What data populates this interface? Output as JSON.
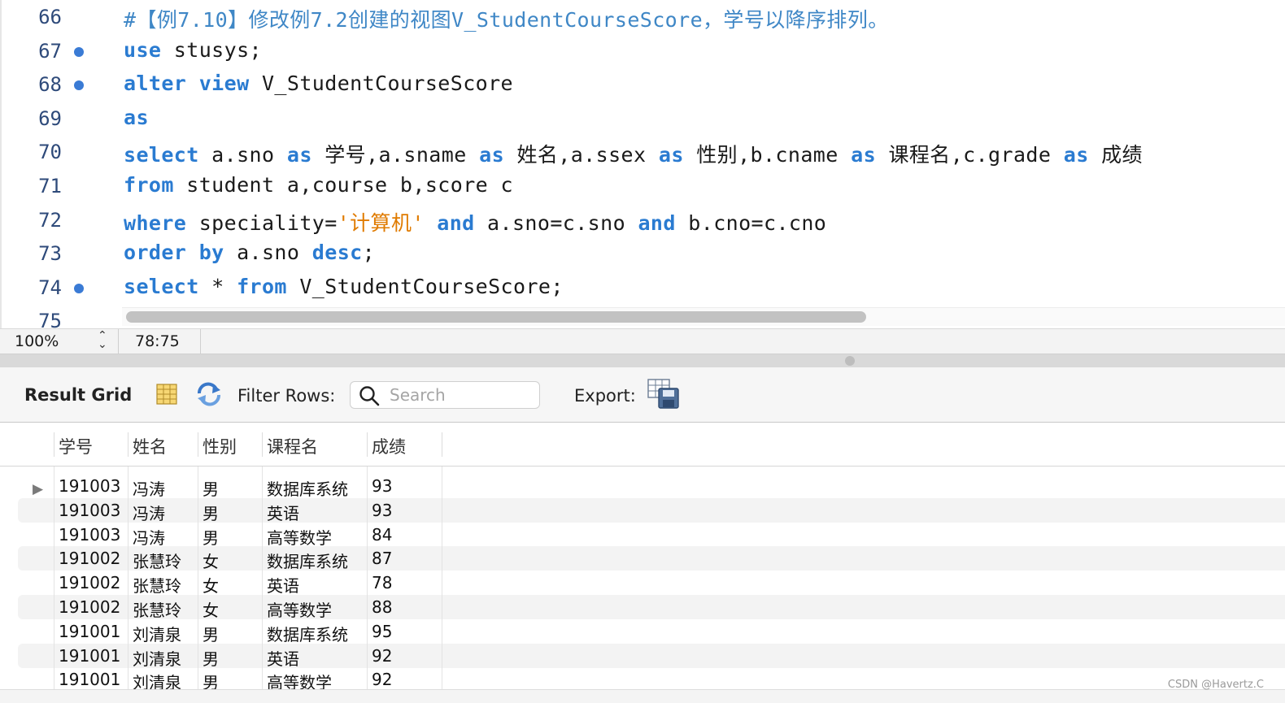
{
  "editor": {
    "lines": [
      {
        "num": "66",
        "breakpoint": false,
        "tokens": [
          {
            "t": "#【例7.10】修改例7.2创建的视图V_StudentCourseScore，学号以降序排列。",
            "c": "cm"
          }
        ]
      },
      {
        "num": "67",
        "breakpoint": true,
        "tokens": [
          {
            "t": "use",
            "c": "kw"
          },
          {
            "t": " stusys;",
            "c": ""
          }
        ]
      },
      {
        "num": "68",
        "breakpoint": true,
        "tokens": [
          {
            "t": "alter",
            "c": "kw"
          },
          {
            "t": " ",
            "c": ""
          },
          {
            "t": "view",
            "c": "kw"
          },
          {
            "t": " V_StudentCourseScore",
            "c": ""
          }
        ]
      },
      {
        "num": "69",
        "breakpoint": false,
        "tokens": [
          {
            "t": "as",
            "c": "kw"
          }
        ]
      },
      {
        "num": "70",
        "breakpoint": false,
        "tokens": [
          {
            "t": "select",
            "c": "kw"
          },
          {
            "t": " a.sno ",
            "c": ""
          },
          {
            "t": "as",
            "c": "kw"
          },
          {
            "t": " 学号,a.sname ",
            "c": ""
          },
          {
            "t": "as",
            "c": "kw"
          },
          {
            "t": " 姓名,a.ssex ",
            "c": ""
          },
          {
            "t": "as",
            "c": "kw"
          },
          {
            "t": " 性别,b.cname ",
            "c": ""
          },
          {
            "t": "as",
            "c": "kw"
          },
          {
            "t": " 课程名,c.grade ",
            "c": ""
          },
          {
            "t": "as",
            "c": "kw"
          },
          {
            "t": " 成绩",
            "c": ""
          }
        ]
      },
      {
        "num": "71",
        "breakpoint": false,
        "tokens": [
          {
            "t": "from",
            "c": "kw"
          },
          {
            "t": " student a,course b,score c",
            "c": ""
          }
        ]
      },
      {
        "num": "72",
        "breakpoint": false,
        "tokens": [
          {
            "t": "where",
            "c": "kw"
          },
          {
            "t": " speciality=",
            "c": ""
          },
          {
            "t": "'计算机'",
            "c": "str"
          },
          {
            "t": " ",
            "c": ""
          },
          {
            "t": "and",
            "c": "kw"
          },
          {
            "t": " a.sno=c.sno ",
            "c": ""
          },
          {
            "t": "and",
            "c": "kw"
          },
          {
            "t": " b.cno=c.cno",
            "c": ""
          }
        ]
      },
      {
        "num": "73",
        "breakpoint": false,
        "tokens": [
          {
            "t": "order by",
            "c": "kw"
          },
          {
            "t": " a.sno ",
            "c": ""
          },
          {
            "t": "desc",
            "c": "kw"
          },
          {
            "t": ";",
            "c": ""
          }
        ]
      },
      {
        "num": "74",
        "breakpoint": true,
        "tokens": [
          {
            "t": "select",
            "c": "kw"
          },
          {
            "t": " * ",
            "c": ""
          },
          {
            "t": "from",
            "c": "kw"
          },
          {
            "t": " V_StudentCourseScore;",
            "c": ""
          }
        ]
      },
      {
        "num": "75",
        "breakpoint": false,
        "tokens": []
      }
    ]
  },
  "statusbar": {
    "zoom": "100%",
    "cursor": "78:75"
  },
  "toolbar": {
    "title": "Result Grid",
    "filter_label": "Filter Rows:",
    "search_placeholder": "Search",
    "search_value": "",
    "export_label": "Export:"
  },
  "grid": {
    "columns": [
      "学号",
      "姓名",
      "性别",
      "课程名",
      "成绩"
    ],
    "rows": [
      [
        "191003",
        "冯涛",
        "男",
        "数据库系统",
        "93"
      ],
      [
        "191003",
        "冯涛",
        "男",
        "英语",
        "93"
      ],
      [
        "191003",
        "冯涛",
        "男",
        "高等数学",
        "84"
      ],
      [
        "191002",
        "张慧玲",
        "女",
        "数据库系统",
        "87"
      ],
      [
        "191002",
        "张慧玲",
        "女",
        "英语",
        "78"
      ],
      [
        "191002",
        "张慧玲",
        "女",
        "高等数学",
        "88"
      ],
      [
        "191001",
        "刘清泉",
        "男",
        "数据库系统",
        "95"
      ],
      [
        "191001",
        "刘清泉",
        "男",
        "英语",
        "92"
      ],
      [
        "191001",
        "刘清泉",
        "男",
        "高等数学",
        "92"
      ]
    ],
    "row_indicator": "▶"
  },
  "watermark": "CSDN @Havertz.C",
  "colors": {
    "keyword": "#2a7bd1",
    "comment": "#3f87c6",
    "string": "#e07b00",
    "breakpoint": "#3a7bd5"
  }
}
